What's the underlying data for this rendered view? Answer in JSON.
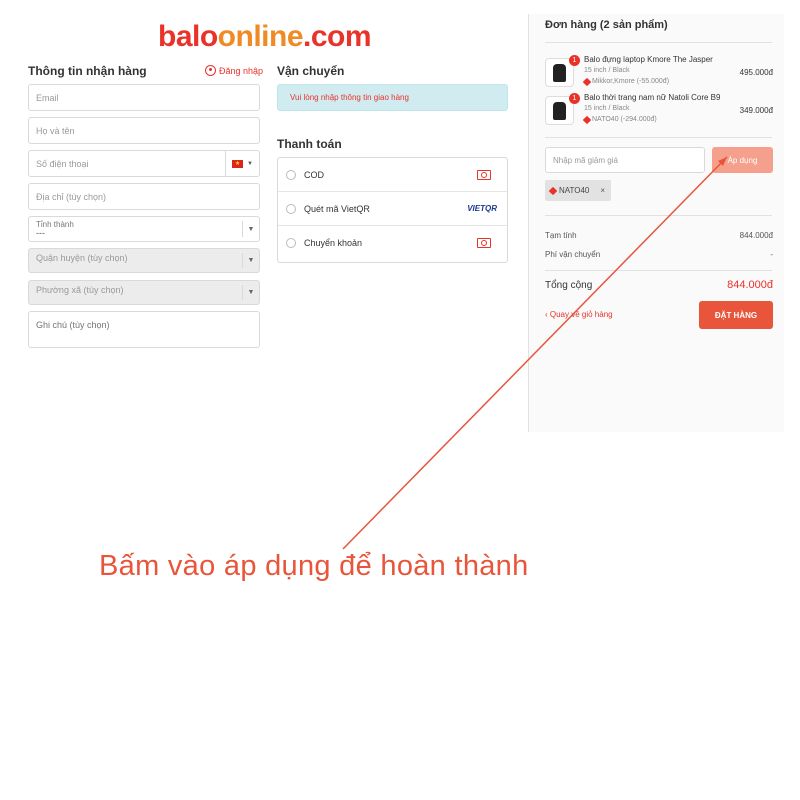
{
  "logo": {
    "part1": "balo",
    "part2": "online",
    "part3": ".com"
  },
  "contact": {
    "heading": "Thông tin nhận hàng",
    "login_label": "Đăng nhập",
    "email_placeholder": "Email",
    "name_placeholder": "Họ và tên",
    "phone_placeholder": "Số điện thoại",
    "address_placeholder": "Địa chỉ (tùy chọn)",
    "province_label": "Tỉnh thành",
    "province_value": "---",
    "district_label": "Quận huyện (tùy chọn)",
    "ward_label": "Phường xã (tùy chọn)",
    "note_placeholder": "Ghi chú (tùy chọn)"
  },
  "shipping": {
    "heading": "Vận chuyển",
    "notice": "Vui lòng nhập thông tin giao hàng"
  },
  "payment": {
    "heading": "Thanh toán",
    "methods": [
      {
        "label": "COD",
        "icon": "cash-icon"
      },
      {
        "label": "Quét mã VietQR",
        "icon": "vietqr-logo"
      },
      {
        "label": "Chuyển khoản",
        "icon": "cash-icon"
      }
    ],
    "vietqr_text": "VIETQR"
  },
  "order": {
    "title": "Đơn hàng (2 sản phẩm)",
    "items": [
      {
        "qty": "1",
        "name": "Balo đựng laptop Kmore The Jasper",
        "variant": "15 inch / Black",
        "promo": "Mikkor,Kmore (-55.000đ)",
        "price": "495.000đ"
      },
      {
        "qty": "1",
        "name": "Balo thời trang nam nữ Natoli Core B9",
        "variant": "15 inch / Black",
        "promo": "NATO40 (-294.000đ)",
        "price": "349.000đ"
      }
    ],
    "coupon_placeholder": "Nhập mã giảm giá",
    "apply_label": "Áp dụng",
    "applied_code": "NATO40",
    "remove_label": "×",
    "subtotal_label": "Tạm tính",
    "subtotal_value": "844.000đ",
    "shipping_label": "Phí vận chuyển",
    "shipping_value": "-",
    "total_label": "Tổng cộng",
    "total_value": "844.000đ",
    "back_label": "‹ Quay về giỏ hàng",
    "place_order_label": "ĐẶT HÀNG"
  },
  "annotation": {
    "caption": "Bấm vào áp dụng để hoàn thành"
  },
  "colors": {
    "brand_red": "#e8322a",
    "brand_orange": "#f08a24",
    "notice_bg": "#d1ecf1",
    "apply_bg": "#f4a08c",
    "order_button": "#e8553b"
  }
}
